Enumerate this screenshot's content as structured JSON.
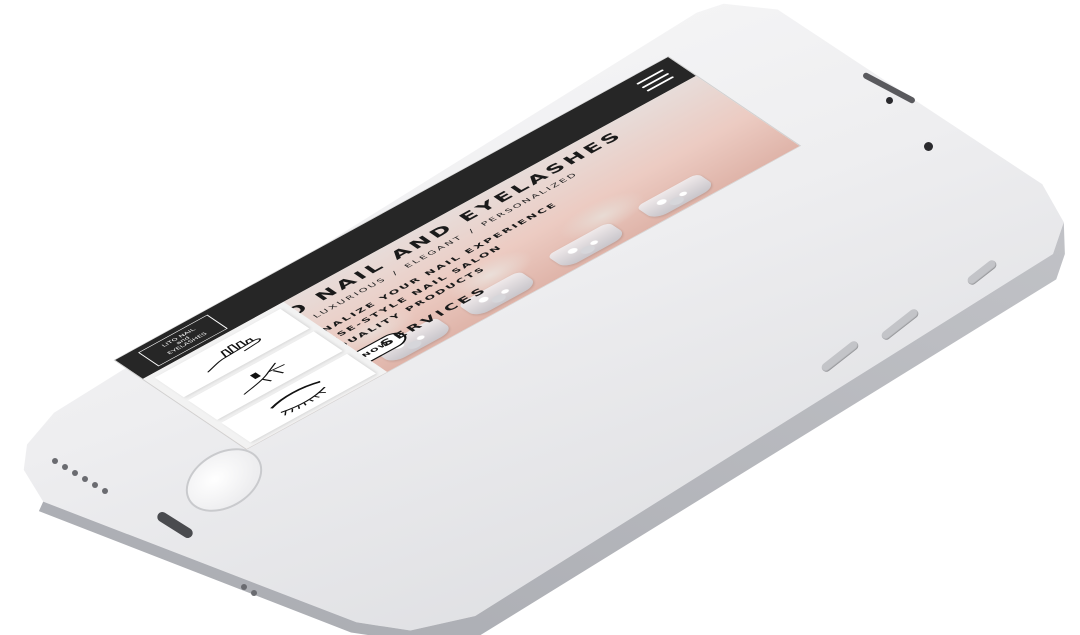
{
  "logo": {
    "line1": "LITO NAIL",
    "line2": "and",
    "line3": "EYELASHES"
  },
  "hero": {
    "title": "LITO NAIL AND EYELASHES",
    "tagline": [
      "LUXURIOUS",
      "ELEGANT",
      "PERSONALIZED"
    ],
    "tagline_separator": "/",
    "features": [
      "PERSONALIZE YOUR NAIL EXPERIENCE",
      "JAPANESE-STYLE NAIL SALON",
      "HIGH-QUALITY PRODUCTS"
    ],
    "cta_label": "BOOK NOW"
  },
  "services": {
    "title": "SERVICES",
    "cards": [
      {
        "icon": "hand-nails-icon"
      },
      {
        "icon": "pedicure-icon"
      },
      {
        "icon": "eyelash-icon"
      }
    ]
  },
  "header": {
    "menu_icon": "hamburger-menu-icon"
  },
  "colors": {
    "header_bg": "#262626",
    "page_bg": "#f6f6f6",
    "hero_pink": "#eccbc2",
    "text_dark": "#1a1a1a"
  }
}
